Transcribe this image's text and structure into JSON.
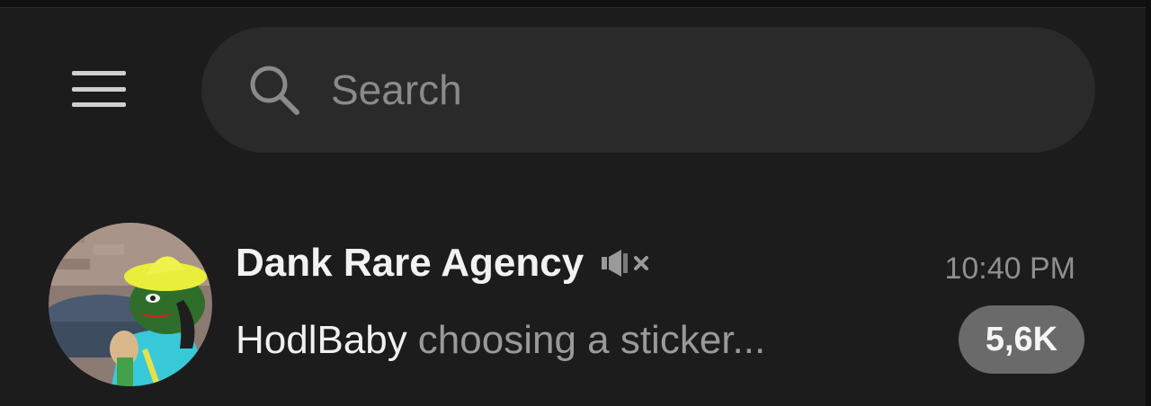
{
  "search": {
    "placeholder": "Search",
    "icon": "search-icon"
  },
  "menu": {
    "icon": "hamburger-menu-icon"
  },
  "chats": [
    {
      "name": "Dank Rare Agency",
      "muted": true,
      "time": "10:40 PM",
      "preview_sender": "HodlBaby",
      "preview_status": "choosing a sticker...",
      "unread": "5,6K",
      "avatar": "pepe-avatar"
    }
  ],
  "colors": {
    "background": "#1c1c1c",
    "search_bg": "#2a2a2a",
    "badge_bg": "#6a6a6a",
    "accent_text": "#f2f2f2",
    "muted_text": "#8f8f8f"
  }
}
